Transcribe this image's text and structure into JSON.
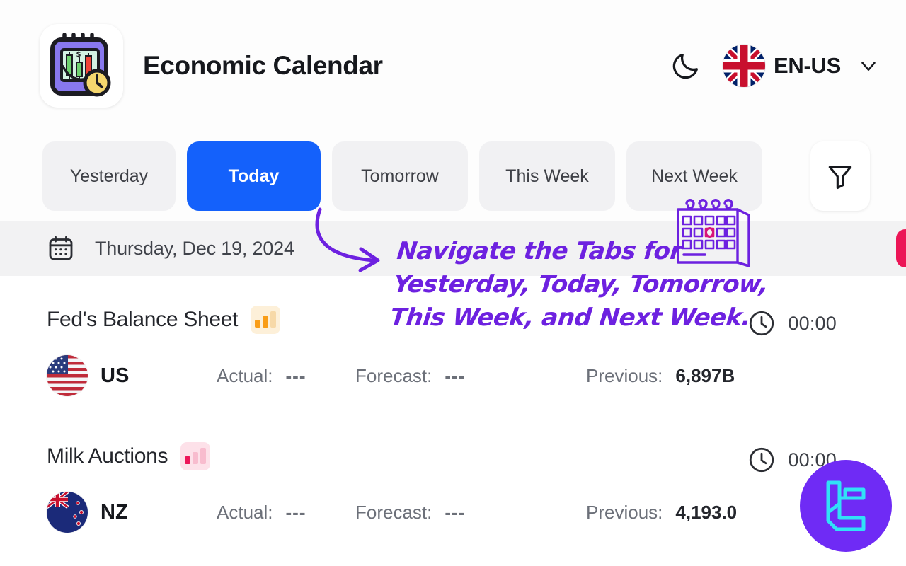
{
  "header": {
    "app_title": "Economic Calendar",
    "logo_icon": "calendar-candlestick-clock-icon",
    "theme_toggle_icon": "moon-icon",
    "language": {
      "label": "EN-US",
      "flag_icon": "uk-flag-icon",
      "chevron_icon": "chevron-down-icon"
    }
  },
  "tabs": {
    "items": [
      {
        "label": "Yesterday",
        "active": false
      },
      {
        "label": "Today",
        "active": true
      },
      {
        "label": "Tomorrow",
        "active": false
      },
      {
        "label": "This Week",
        "active": false
      },
      {
        "label": "Next Week",
        "active": false
      }
    ],
    "filter_icon": "filter-funnel-icon",
    "active_color": "#1461fb",
    "inactive_bg": "#f1f1f3"
  },
  "date_bar": {
    "calendar_icon": "calendar-icon",
    "date": "Thursday, Dec 19, 2024",
    "badge_color": "#ec1556"
  },
  "labels": {
    "actual": "Actual:",
    "forecast": "Forecast:",
    "previous": "Previous:",
    "clock_icon": "clock-icon"
  },
  "events": [
    {
      "title": "Fed's Balance Sheet",
      "impact": "medium",
      "impact_icon": "impact-bars-icon",
      "impact_color": "#f99d17",
      "time": "00:00",
      "country": "US",
      "flag_icon": "us-flag-icon",
      "actual": "---",
      "forecast": "---",
      "previous": "6,897B"
    },
    {
      "title": "Milk Auctions",
      "impact": "low",
      "impact_icon": "impact-bars-icon",
      "impact_color": "#ed1559",
      "time": "00:00",
      "country": "NZ",
      "flag_icon": "nz-flag-icon",
      "actual": "---",
      "forecast": "---",
      "previous": "4,193.0"
    }
  ],
  "annotation": {
    "line1": "Navigate the Tabs for",
    "line2": "Yesterday, Today, Tomorrow,",
    "line3": "This Week, and Next Week.",
    "color": "#6d21e0",
    "arrow_icon": "curved-arrow-icon",
    "sticker_icon": "desk-calendar-doodle-icon"
  },
  "fab": {
    "icon": "lc-monogram-logo-icon",
    "background": "#6f2bf5",
    "accent": "#31e1f7"
  }
}
